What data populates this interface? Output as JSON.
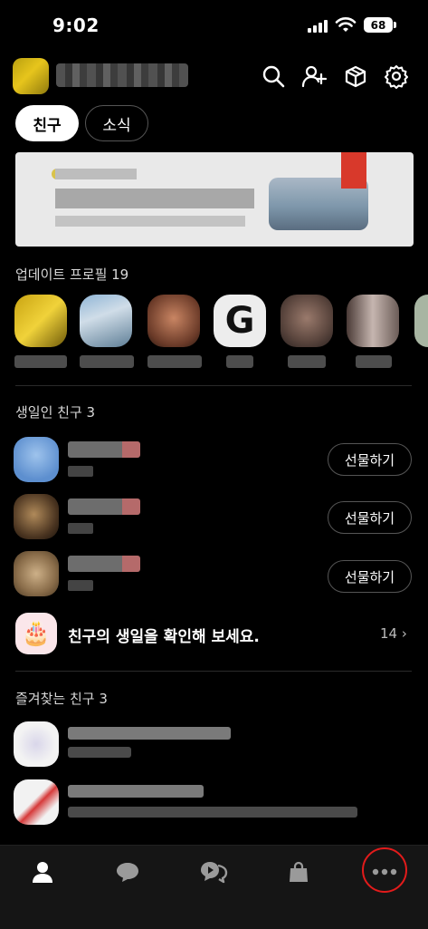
{
  "status_bar": {
    "time": "9:02",
    "battery": "68"
  },
  "tabs": [
    {
      "label": "친구",
      "active": true
    },
    {
      "label": "소식",
      "active": false
    }
  ],
  "sections": {
    "updated_profiles": "업데이트 프로필 19",
    "birthday_friends": "생일인 친구 3",
    "favorites": "즐겨찾는 친구 3"
  },
  "birthday": {
    "gift_label": "선물하기",
    "check_text": "친구의 생일을 확인해 보세요.",
    "check_count": "14 ›"
  },
  "icons": {
    "header": [
      "search-icon",
      "add-friend-icon",
      "gift-box-icon",
      "settings-icon"
    ],
    "nav": [
      "friends-icon",
      "chat-icon",
      "openchat-icon",
      "shopping-icon",
      "more-icon"
    ]
  },
  "colors": {
    "highlight_circle": "#e21b1b"
  }
}
